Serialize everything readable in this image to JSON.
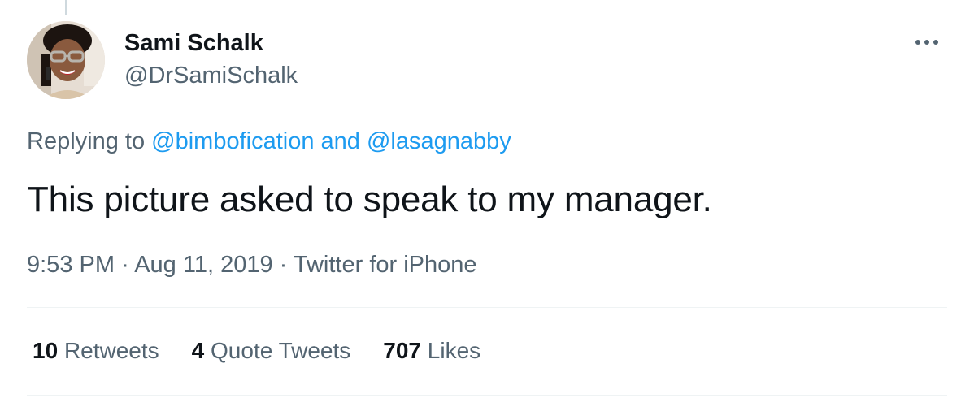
{
  "tweet": {
    "author": {
      "display_name": "Sami Schalk",
      "handle": "@DrSamiSchalk"
    },
    "reply_context": {
      "prefix": "Replying to",
      "mention_1": "@bimbofication",
      "conjunction": "and",
      "mention_2": "@lasagnabby"
    },
    "text": "This picture asked to speak to my manager.",
    "meta": {
      "time": "9:53 PM",
      "separator": "·",
      "date": "Aug 11, 2019",
      "source": "Twitter for iPhone"
    },
    "stats": {
      "retweets_count": "10",
      "retweets_label": "Retweets",
      "quotes_count": "4",
      "quotes_label": "Quote Tweets",
      "likes_count": "707",
      "likes_label": "Likes"
    }
  },
  "icons": {
    "more": "more-horizontal-icon"
  },
  "colors": {
    "primary_text": "#0f1419",
    "secondary_text": "#536471",
    "link": "#1d9bf0",
    "divider": "#eff3f4"
  }
}
